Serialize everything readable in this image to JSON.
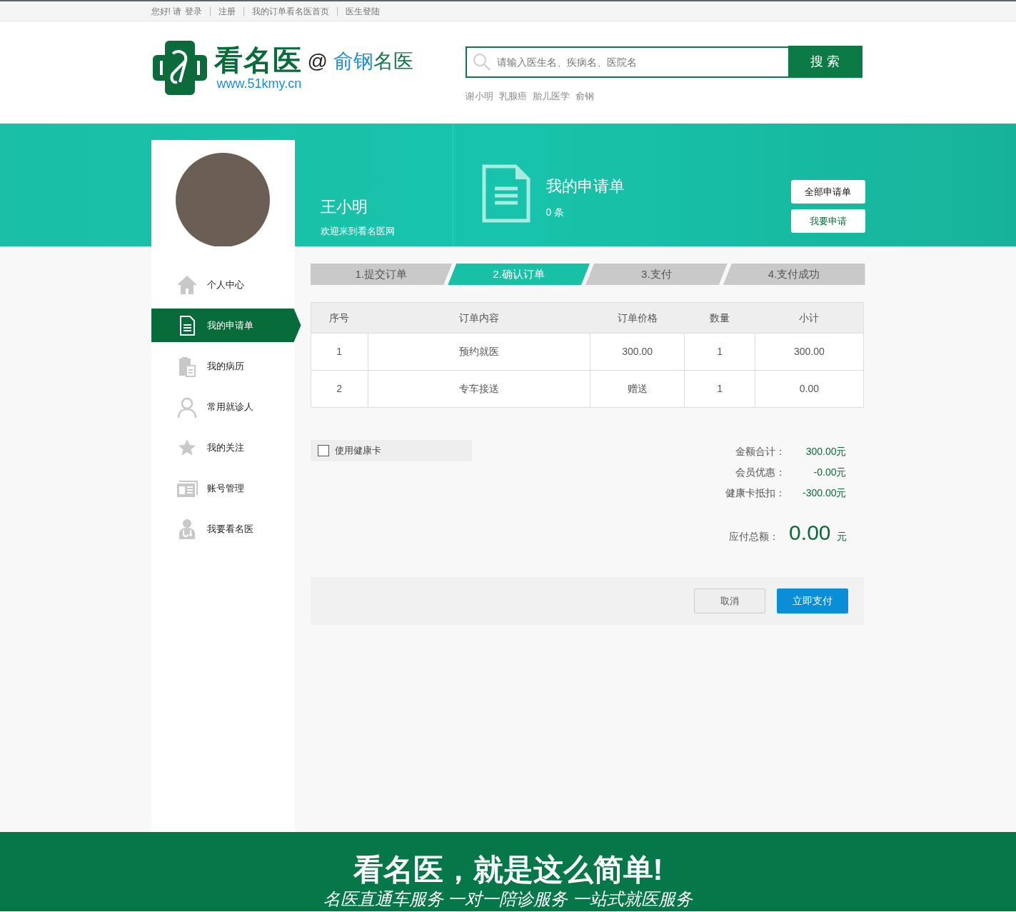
{
  "top_links": [
    "您好! 请",
    "登录",
    "注册",
    "我的订单",
    "看名医首页",
    "医生登陆"
  ],
  "logo": {
    "name": "看名医",
    "url": "www.51kmy.cn",
    "at": "@",
    "partner": "俞钢",
    "partner_suffix": "名医"
  },
  "search": {
    "placeholder": "请输入医生名、疾病名、医院名",
    "button": "搜 索",
    "hot": [
      "谢小明",
      "乳腺癌",
      "胎儿医学",
      "俞钢"
    ]
  },
  "profile": {
    "name": "王小明",
    "welcome": "欢迎来到看名医网"
  },
  "summary_card": {
    "title": "我的申请单",
    "count": "0 条",
    "buttons": [
      "全部申请单",
      "我要申请"
    ]
  },
  "sidebar": {
    "items": [
      {
        "label": "个人中心",
        "kind": "home",
        "selected": false
      },
      {
        "label": "我的申请单",
        "kind": "doc",
        "selected": true
      },
      {
        "label": "我的病历",
        "kind": "clipboard",
        "selected": false
      },
      {
        "label": "常用就诊人",
        "kind": "person",
        "selected": false
      },
      {
        "label": "我的关注",
        "kind": "star",
        "selected": false
      },
      {
        "label": "账号管理",
        "kind": "card",
        "selected": false
      },
      {
        "label": "我要看名医",
        "kind": "doctor",
        "selected": false
      }
    ]
  },
  "steps": [
    {
      "label": "1.提交订单",
      "selected": false
    },
    {
      "label": "2.确认订单",
      "selected": true
    },
    {
      "label": "3.支付",
      "selected": false
    },
    {
      "label": "4.支付成功",
      "selected": false
    }
  ],
  "table": {
    "columns": [
      "序号",
      "订单内容",
      "订单价格",
      "数量",
      "小计"
    ],
    "rows": [
      [
        "1",
        "预约就医",
        "300.00",
        "1",
        "300.00"
      ],
      [
        "2",
        "专车接送",
        "赠送",
        "1",
        "0.00"
      ]
    ]
  },
  "health_card": {
    "label": "使用健康卡",
    "checked": false
  },
  "totals": [
    {
      "label": "金额合计：",
      "value": "300.00元"
    },
    {
      "label": "会员优惠：",
      "value": "-0.00元"
    },
    {
      "label": "健康卡抵扣：",
      "value": "-300.00元"
    }
  ],
  "payable": {
    "label": "应付总额：",
    "amount": "0.00",
    "unit": "元"
  },
  "actions": {
    "cancel": "取消",
    "pay": "立即支付"
  },
  "footer": {
    "slogan": "看名医，就是这么简单!",
    "services": "名医直通车服务 一对一陪诊服务 一站式就医服务"
  }
}
